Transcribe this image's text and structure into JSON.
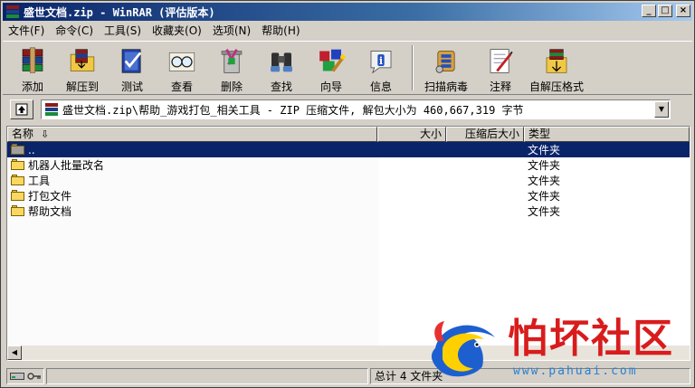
{
  "window": {
    "title": "盛世文档.zip - WinRAR (评估版本)",
    "buttons": {
      "minimize": "_",
      "maximize": "□",
      "close": "×"
    }
  },
  "menu": [
    {
      "label": "文件(F)"
    },
    {
      "label": "命令(C)"
    },
    {
      "label": "工具(S)"
    },
    {
      "label": "收藏夹(O)"
    },
    {
      "label": "选项(N)"
    },
    {
      "label": "帮助(H)"
    }
  ],
  "toolbar": {
    "add": "添加",
    "extract_to": "解压到",
    "test": "测试",
    "view": "查看",
    "delete": "删除",
    "find": "查找",
    "wizard": "向导",
    "info": "信息",
    "scan": "扫描病毒",
    "comment": "注释",
    "sfx": "自解压格式"
  },
  "address": {
    "path": "盛世文档.zip\\帮助_游戏打包_相关工具 - ZIP 压缩文件, 解包大小为 460,667,319 字节"
  },
  "columns": {
    "name": "名称",
    "size": "大小",
    "packed": "压缩后大小",
    "type": "类型"
  },
  "files": [
    {
      "name": "..",
      "type": "文件夹",
      "selected": true
    },
    {
      "name": "机器人批量改名",
      "type": "文件夹"
    },
    {
      "name": "工具",
      "type": "文件夹"
    },
    {
      "name": "打包文件",
      "type": "文件夹"
    },
    {
      "name": "帮助文档",
      "type": "文件夹"
    }
  ],
  "status": {
    "total": "总计 4 文件夹"
  },
  "watermark": {
    "name": "怕坏社区",
    "url": "www.pahuai.com"
  },
  "colors": {
    "titlebar": "#0a246a",
    "selection": "#0a246a",
    "face": "#d4d0c8",
    "watermark_red": "#d81c1c",
    "watermark_blue": "#2a7fd0"
  }
}
